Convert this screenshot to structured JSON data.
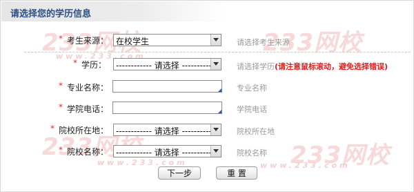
{
  "header": {
    "title": "请选择您的学历信息"
  },
  "watermark": {
    "logo_text": "233网校",
    "url_text": "www.233.com"
  },
  "fields": [
    {
      "label": "考生来源：",
      "type": "select",
      "value": "在校学生",
      "hint": "请选择考生来源",
      "warning": ""
    },
    {
      "label": "学历：",
      "type": "select",
      "value": "------------ 请选择 -----------",
      "hint": "请选择学历",
      "warning": "(请注意鼠标滚动，避免选择错误)"
    },
    {
      "label": "专业名称：",
      "type": "input",
      "value": "",
      "hint": "专业名称",
      "warning": ""
    },
    {
      "label": "学院电话：",
      "type": "input",
      "value": "",
      "hint": "学院电话",
      "warning": ""
    },
    {
      "label": "院校所在地：",
      "type": "select",
      "value": "------------ 请选择 -----------",
      "hint": "院校所在地",
      "warning": ""
    },
    {
      "label": "院校名称：",
      "type": "select",
      "value": "------------ 请选择 -----------",
      "hint": "院校名称",
      "warning": ""
    }
  ],
  "required_marker": "*",
  "buttons": {
    "next": "下一步",
    "reset": "重 置"
  },
  "colors": {
    "title": "#2b4f86",
    "required": "#e03030",
    "warning": "#e02020",
    "hint": "#9a9a9a"
  }
}
